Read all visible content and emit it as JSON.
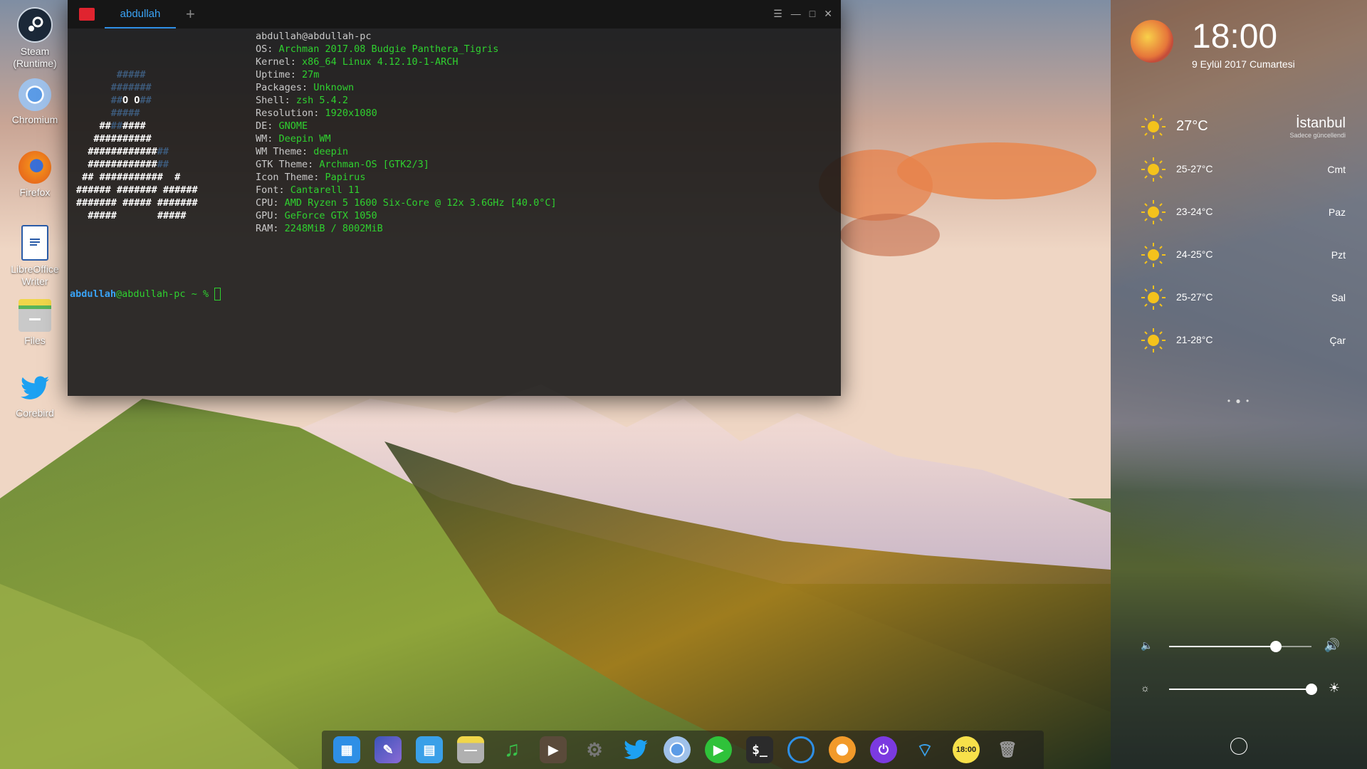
{
  "desktop": {
    "icons": [
      {
        "label": "Steam (Runtime)",
        "icon": "steam-icon"
      },
      {
        "label": "Chromium",
        "icon": "chromium-icon"
      },
      {
        "label": "Firefox",
        "icon": "firefox-icon"
      },
      {
        "label": "LibreOffice Writer",
        "icon": "writer-icon"
      },
      {
        "label": "Files",
        "icon": "files-icon"
      },
      {
        "label": "Corebird",
        "icon": "corebird-icon"
      }
    ]
  },
  "terminal": {
    "tab_label": "abdullah",
    "new_tab": "+",
    "header": "abdullah@abdullah-pc",
    "info": [
      {
        "key": "OS: ",
        "value": "Archman 2017.08 Budgie Panthera_Tigris"
      },
      {
        "key": "Kernel: ",
        "value": "x86_64 Linux 4.12.10-1-ARCH"
      },
      {
        "key": "Uptime: ",
        "value": "27m"
      },
      {
        "key": "Packages: ",
        "value": "Unknown"
      },
      {
        "key": "Shell: ",
        "value": "zsh 5.4.2"
      },
      {
        "key": "Resolution: ",
        "value": "1920x1080"
      },
      {
        "key": "DE: ",
        "value": "GNOME"
      },
      {
        "key": "WM: ",
        "value": "Deepin WM"
      },
      {
        "key": "WM Theme: ",
        "value": "deepin"
      },
      {
        "key": "GTK Theme: ",
        "value": "Archman-OS [GTK2/3]"
      },
      {
        "key": "Icon Theme: ",
        "value": "Papirus"
      },
      {
        "key": "Font: ",
        "value": "Cantarell 11"
      },
      {
        "key": "CPU: ",
        "value": "AMD Ryzen 5 1600 Six-Core @ 12x 3.6GHz [40.0°C]"
      },
      {
        "key": "GPU: ",
        "value": "GeForce GTX 1050"
      },
      {
        "key": "RAM: ",
        "value": "2248MiB / 8002MiB"
      }
    ],
    "prompt_user": "abdullah",
    "prompt_rest": "@abdullah-pc ~ % "
  },
  "panel": {
    "time": "18:00",
    "date": "9 Eylül 2017 Cumartesi",
    "weather": {
      "current_temp": "27°C",
      "city": "İstanbul",
      "status": "Sadece güncellendi",
      "forecast": [
        {
          "temp": "25-27°C",
          "day": "Cmt"
        },
        {
          "temp": "23-24°C",
          "day": "Paz"
        },
        {
          "temp": "24-25°C",
          "day": "Pzt"
        },
        {
          "temp": "25-27°C",
          "day": "Sal"
        },
        {
          "temp": "21-28°C",
          "day": "Çar"
        }
      ]
    },
    "volume_level": 0.75,
    "brightness_level": 1.0
  },
  "dock": {
    "items": [
      "launcher-icon",
      "editor-icon",
      "multitask-icon",
      "files-icon",
      "music-icon",
      "video-icon",
      "settings-icon",
      "twitter-icon",
      "chromium-icon",
      "player-icon",
      "terminal-icon",
      "monitor-icon",
      "browser-icon",
      "power-icon",
      "wifi-icon",
      "clock-icon",
      "trash-icon"
    ],
    "clock_label": "18:00",
    "terminal_label": "$_"
  },
  "colors": {
    "accent": "#2f8fe6",
    "term_green": "#2fd12f",
    "term_red": "#e0242f"
  }
}
